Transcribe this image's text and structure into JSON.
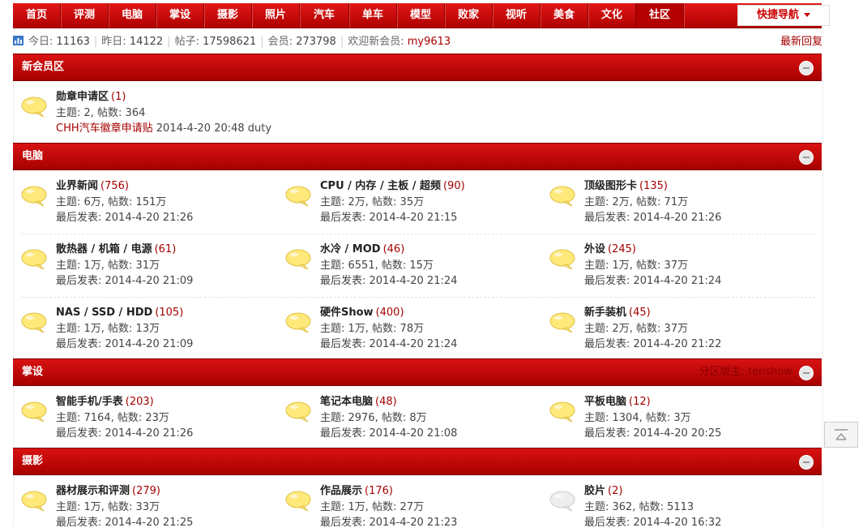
{
  "nav": {
    "items": [
      "首页",
      "评测",
      "电脑",
      "掌设",
      "摄影",
      "照片",
      "汽车",
      "单车",
      "模型",
      "败家",
      "视听",
      "美食",
      "文化",
      "社区"
    ],
    "active_index": 13,
    "quick_nav_label": "快捷导航"
  },
  "stats": {
    "today_label": "今日:",
    "today": "11163",
    "yesterday_label": "昨日:",
    "yesterday": "14122",
    "posts_label": "帖子:",
    "posts": "17598621",
    "members_label": "会员:",
    "members": "273798",
    "welcome_label": "欢迎新会员:",
    "new_member": "my9613",
    "latest_reply": "最新回复"
  },
  "sections": [
    {
      "title": "新会员区",
      "moderator": "",
      "forums": [
        {
          "name": "勋章申请区",
          "count": "(1)",
          "stats": "主题: 2, 帖数: 364",
          "last_link": "CHH汽车徽章申请贴",
          "last_time": "2014-4-20 20:48 duty",
          "new": true
        }
      ]
    },
    {
      "title": "电脑",
      "moderator": "",
      "forums": [
        {
          "name": "业界新闻",
          "count": "(756)",
          "stats": "主题: 6万, 帖数: 151万",
          "last": "最后发表: 2014-4-20 21:26",
          "new": true
        },
        {
          "name": "CPU / 内存 / 主板 / 超频",
          "count": "(90)",
          "stats": "主题: 2万, 帖数: 35万",
          "last": "最后发表: 2014-4-20 21:15",
          "new": true
        },
        {
          "name": "顶级图形卡",
          "count": "(135)",
          "stats": "主题: 2万, 帖数: 71万",
          "last": "最后发表: 2014-4-20 21:26",
          "new": true
        },
        {
          "name": "散热器 / 机箱 / 电源",
          "count": "(61)",
          "stats": "主题: 1万, 帖数: 31万",
          "last": "最后发表: 2014-4-20 21:09",
          "new": true
        },
        {
          "name": "水冷 / MOD",
          "count": "(46)",
          "stats": "主题: 6551, 帖数: 15万",
          "last": "最后发表: 2014-4-20 21:24",
          "new": true
        },
        {
          "name": "外设",
          "count": "(245)",
          "stats": "主题: 1万, 帖数: 37万",
          "last": "最后发表: 2014-4-20 21:24",
          "new": true
        },
        {
          "name": "NAS / SSD / HDD",
          "count": "(105)",
          "stats": "主题: 1万, 帖数: 13万",
          "last": "最后发表: 2014-4-20 21:09",
          "new": true
        },
        {
          "name": "硬件Show",
          "count": "(400)",
          "stats": "主题: 1万, 帖数: 78万",
          "last": "最后发表: 2014-4-20 21:24",
          "new": true
        },
        {
          "name": "新手装机",
          "count": "(45)",
          "stats": "主题: 2万, 帖数: 37万",
          "last": "最后发表: 2014-4-20 21:22",
          "new": true
        }
      ]
    },
    {
      "title": "掌设",
      "moderator": "分区版主: tenshow",
      "forums": [
        {
          "name": "智能手机/手表",
          "count": "(203)",
          "stats": "主题: 7164, 帖数: 23万",
          "last": "最后发表: 2014-4-20 21:26",
          "new": true
        },
        {
          "name": "笔记本电脑",
          "count": "(48)",
          "stats": "主题: 2976, 帖数: 8万",
          "last": "最后发表: 2014-4-20 21:08",
          "new": true
        },
        {
          "name": "平板电脑",
          "count": "(12)",
          "stats": "主题: 1304, 帖数: 3万",
          "last": "最后发表: 2014-4-20 20:25",
          "new": true
        }
      ]
    },
    {
      "title": "摄影",
      "moderator": "",
      "forums": [
        {
          "name": "器材展示和评测",
          "count": "(279)",
          "stats": "主题: 1万, 帖数: 33万",
          "last": "最后发表: 2014-4-20 21:25",
          "new": true
        },
        {
          "name": "作品展示",
          "count": "(176)",
          "stats": "主题: 1万, 帖数: 27万",
          "last": "最后发表: 2014-4-20 21:23",
          "new": true
        },
        {
          "name": "胶片",
          "count": "(2)",
          "stats": "主题: 362, 帖数: 5113",
          "last": "最后发表: 2014-4-20 16:32",
          "new": false
        }
      ]
    }
  ],
  "colors": {
    "brand_red": "#c00000",
    "link_red": "#a50000",
    "bubble_new": "#ffe97a",
    "bubble_old": "#eeeeee"
  }
}
